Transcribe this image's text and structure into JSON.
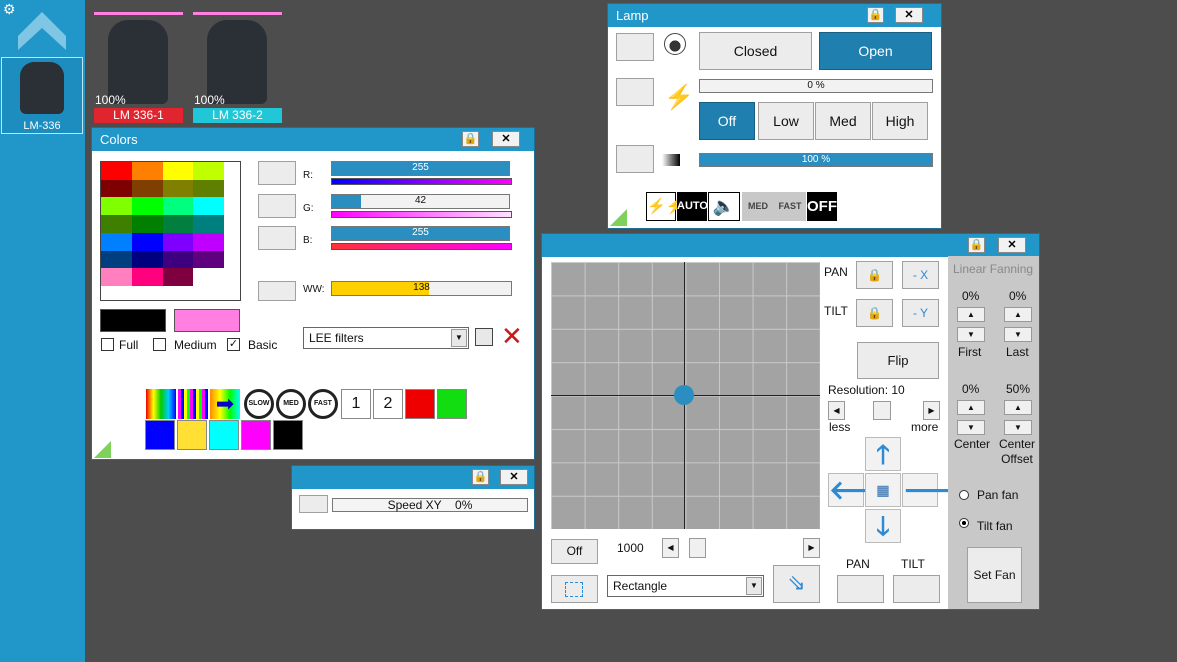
{
  "sidebar": {
    "fixture_label": "LM-336",
    "gear_icon": "gear-icon",
    "up_icon": "chevron-up-icon"
  },
  "fixtures": [
    {
      "name": "LM 336-1",
      "level": "100%",
      "color": "#e0252f"
    },
    {
      "name": "LM 336-2",
      "level": "100%",
      "color": "#21c7d6"
    }
  ],
  "colors": {
    "title": "Colors",
    "rgb_labels": [
      "R:",
      "G:",
      "B:"
    ],
    "r_value": "255",
    "g_value": "42",
    "b_value": "255",
    "ww_label": "WW:",
    "ww_value": "138",
    "r_level": 1.0,
    "g_level": 0.165,
    "b_level": 1.0,
    "ww_level": 0.54,
    "palette": [
      "#ff0000",
      "#ff7f00",
      "#ffff00",
      "#bfff00",
      "#7f0000",
      "#7f3f00",
      "#7f7f00",
      "#5f7f00",
      "#7fff00",
      "#00ff00",
      "#00ff7f",
      "#00ffff",
      "#3f7f00",
      "#007f00",
      "#007f3f",
      "#007f7f",
      "#007fff",
      "#0000ff",
      "#7f00ff",
      "#bf00ff",
      "#003f7f",
      "#00007f",
      "#3f007f",
      "#5f007f",
      "#ff7fbf",
      "#ff007f",
      "#7f003f",
      "#ffffff"
    ],
    "current_color": "#000000",
    "target_color": "#ff80e0",
    "checkboxes": [
      {
        "label": "Full",
        "checked": false
      },
      {
        "label": "Medium",
        "checked": false
      },
      {
        "label": "Basic",
        "checked": true
      }
    ],
    "filter_select": "LEE filters",
    "chips_row2": [
      "#0000ff",
      "#ffe033",
      "#00ffff",
      "#ff00ff",
      "#000000"
    ],
    "chip_labels": [
      "1",
      "2"
    ],
    "chip_colors": [
      "#ee0000",
      "#11dd11"
    ],
    "speed_labels": [
      "SLOW",
      "MED",
      "FAST"
    ]
  },
  "speed": {
    "label": "Speed XY",
    "value": "0%"
  },
  "lamp": {
    "title": "Lamp",
    "closed": "Closed",
    "open": "Open",
    "level1": "0 %",
    "level1_fraction": 0.0,
    "modes": [
      "Off",
      "Low",
      "Med",
      "High"
    ],
    "level2": "100 %",
    "level2_fraction": 1.0,
    "icon_labels": [
      "AUTO",
      "MED",
      "FAST",
      "OFF"
    ]
  },
  "pantilt": {
    "pan_label": "PAN",
    "tilt_label": "TILT",
    "minus_x": "- X",
    "minus_y": "- Y",
    "flip": "Flip",
    "resolution": "Resolution: 10",
    "less": "less",
    "more": "more",
    "off": "Off",
    "speed_value": "1000",
    "shape": "Rectangle",
    "pan_bottom": "PAN",
    "tilt_bottom": "TILT"
  },
  "fanning": {
    "title": "Linear Fanning",
    "first_pct": "0%",
    "last_pct": "0%",
    "first": "First",
    "last": "Last",
    "center_pct": "0%",
    "offset_pct": "50%",
    "center": "Center",
    "offset": "Center\nOffset",
    "pan_fan": "Pan fan",
    "tilt_fan": "Tilt fan",
    "set_fan": "Set Fan"
  }
}
